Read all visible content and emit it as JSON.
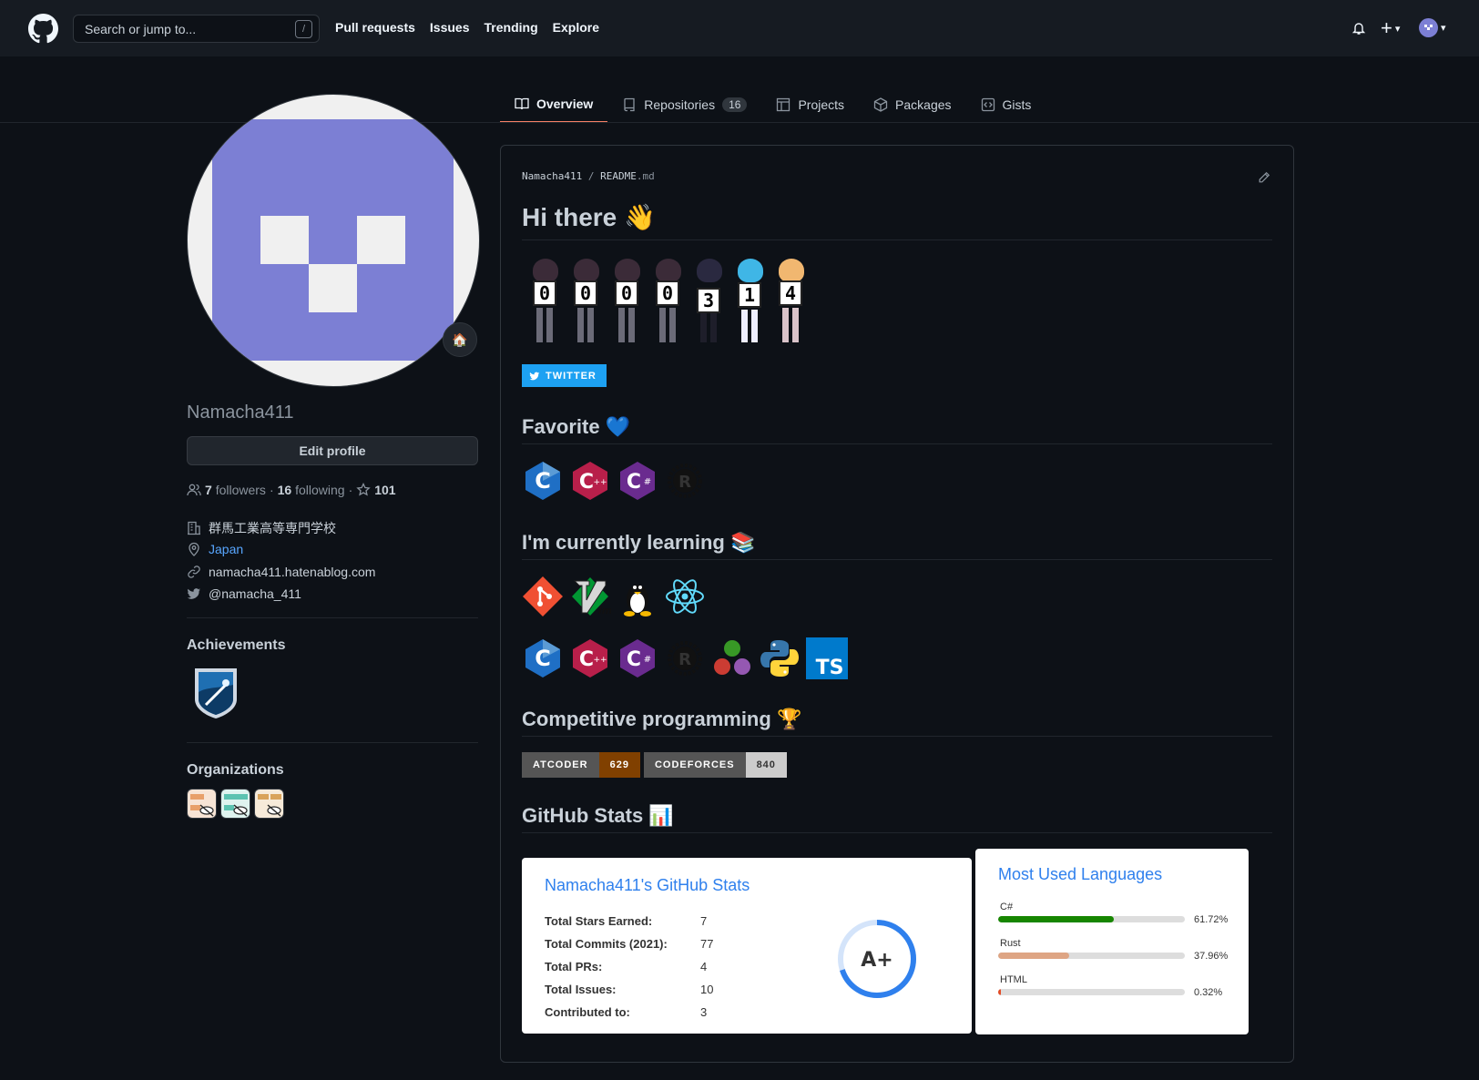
{
  "header": {
    "search_placeholder": "Search or jump to...",
    "slash_key": "/",
    "nav": [
      "Pull requests",
      "Issues",
      "Trending",
      "Explore"
    ],
    "plus": "+",
    "caret": "▾"
  },
  "tabs": [
    {
      "label": "Overview",
      "icon": "book-icon"
    },
    {
      "label": "Repositories",
      "count": "16",
      "icon": "repo-icon"
    },
    {
      "label": "Projects",
      "icon": "project-icon"
    },
    {
      "label": "Packages",
      "icon": "package-icon"
    },
    {
      "label": "Gists",
      "icon": "code-square-icon"
    }
  ],
  "profile": {
    "username": "Namacha411",
    "status_emoji": "🏠",
    "edit_label": "Edit profile",
    "followers_count": "7",
    "followers_label": "followers",
    "dot": "·",
    "following_count": "16",
    "following_label": "following",
    "stars_count": "101",
    "org_name": "群馬工業高等専門学校",
    "location": "Japan",
    "website": "namacha411.hatenablog.com",
    "twitter": "@namacha_411",
    "achievements_label": "Achievements",
    "organizations_label": "Organizations"
  },
  "readme": {
    "owner": "Namacha411",
    "separator": "/",
    "file": "README",
    "ext": ".md",
    "title": "Hi there",
    "title_emoji": "👋",
    "counter_digits": [
      "0",
      "0",
      "0",
      "0",
      "3",
      "1",
      "4"
    ],
    "twitter_badge": "TWITTER",
    "favorite_heading": "Favorite",
    "favorite_emoji": "💙",
    "favorite_icons": [
      "C",
      "C++",
      "C#",
      "R"
    ],
    "learning_heading": "I'm currently learning",
    "learning_emoji": "📚",
    "learning_icons_1": [
      "git",
      "vim",
      "linux",
      "react"
    ],
    "learning_icons_2": [
      "C",
      "C++",
      "C#",
      "R",
      "julia",
      "python",
      "TS"
    ],
    "cp_heading": "Competitive programming",
    "cp_emoji": "🏆",
    "atcoder_label": "ATCODER",
    "atcoder_value": "629",
    "codeforces_label": "CODEFORCES",
    "codeforces_value": "840",
    "stats_heading": "GitHub Stats",
    "stats_emoji": "📊"
  },
  "stats_card": {
    "title": "Namacha411's GitHub Stats",
    "rows": [
      {
        "label": "Total Stars Earned:",
        "value": "7"
      },
      {
        "label": "Total Commits (2021):",
        "value": "77"
      },
      {
        "label": "Total PRs:",
        "value": "4"
      },
      {
        "label": "Total Issues:",
        "value": "10"
      },
      {
        "label": "Contributed to:",
        "value": "3"
      }
    ],
    "grade": "A+",
    "grade_fraction": 0.7
  },
  "langs_card": {
    "title": "Most Used Languages",
    "langs": [
      {
        "name": "C#",
        "pct": "61.72%",
        "value": 61.72,
        "color": "#178600"
      },
      {
        "name": "Rust",
        "pct": "37.96%",
        "value": 37.96,
        "color": "#dea584"
      },
      {
        "name": "HTML",
        "pct": "0.32%",
        "value": 0.32,
        "color": "#e34c26"
      }
    ]
  },
  "colors": {
    "accent": "#58a6ff",
    "tab_underline": "#f78166",
    "atcoder": "#804000",
    "codeforces": "#cccccc",
    "twitter": "#1da1f2"
  }
}
